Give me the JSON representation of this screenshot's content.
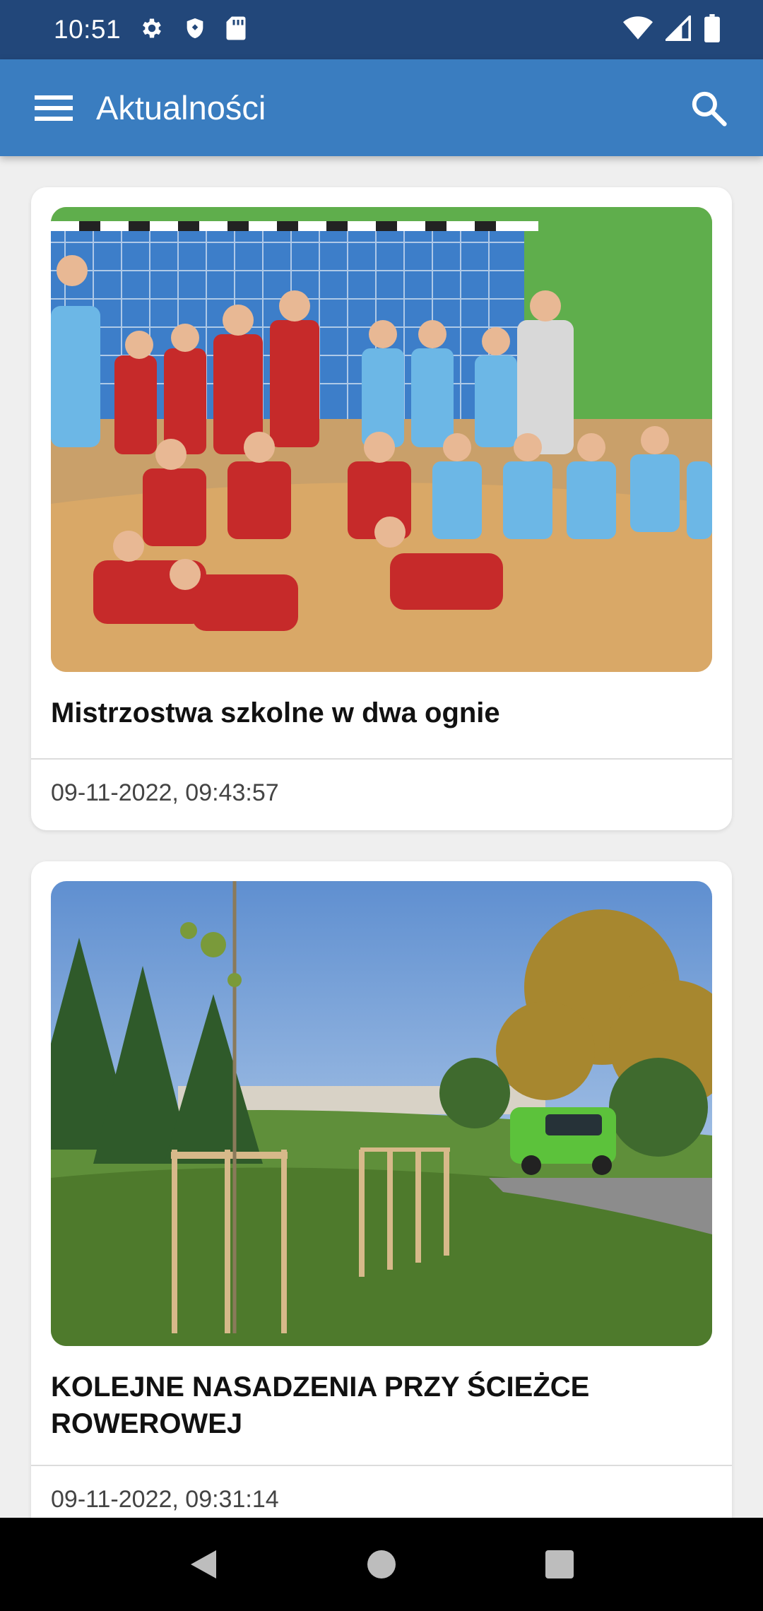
{
  "status_bar": {
    "time": "10:51",
    "left_icons": [
      "gear-icon",
      "shield-icon",
      "sd-card-icon"
    ],
    "right_icons": [
      "wifi-icon",
      "signal-icon",
      "battery-icon"
    ]
  },
  "app_bar": {
    "title": "Aktualności",
    "menu_icon": "hamburger-menu-icon",
    "search_icon": "search-icon",
    "color": "#3a7dc0",
    "status_color": "#22477a"
  },
  "news": [
    {
      "title": "Mistrzostwa szkolne w dwa ognie",
      "date": "09-11-2022, 09:43:57",
      "image": "team-photo-gym"
    },
    {
      "title": "KOLEJNE NASADZENIA PRZY ŚCIEŻCE ROWEROWEJ",
      "date": "09-11-2022, 09:31:14",
      "image": "tree-planting-bike-path"
    }
  ],
  "nav_bar": {
    "icons": [
      "back-icon",
      "home-icon",
      "recents-icon"
    ]
  }
}
